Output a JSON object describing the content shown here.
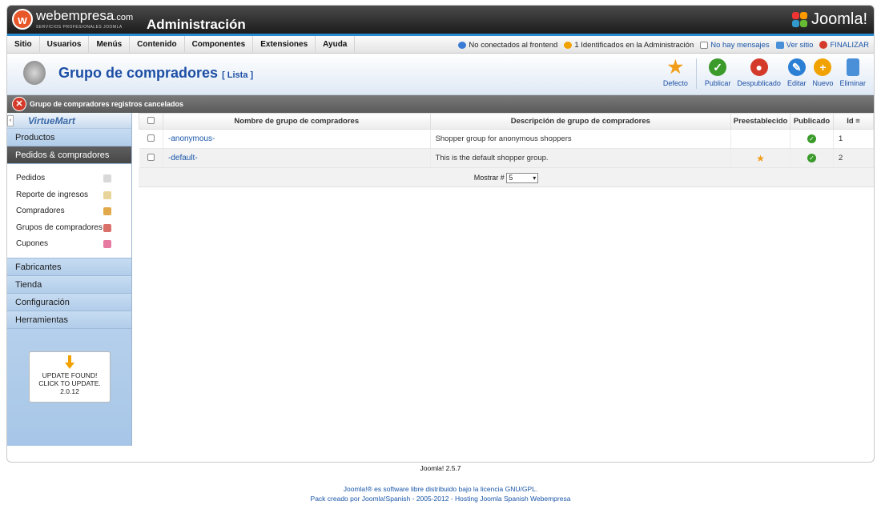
{
  "header": {
    "brand_name": "webempresa",
    "brand_suffix": ".com",
    "brand_tagline": "SERVICIOS PROFESIONALES JOOMLA",
    "title": "Administración",
    "cms_logo": "Joomla!"
  },
  "menu": [
    "Sitio",
    "Usuarios",
    "Menús",
    "Contenido",
    "Componentes",
    "Extensiones",
    "Ayuda"
  ],
  "status": {
    "frontend": "No conectados al frontend",
    "admin": "1 Identificados en la Administración",
    "messages": "No hay mensajes",
    "view_site": "Ver sitio",
    "logout": "FINALIZAR"
  },
  "toolbar": {
    "title": "Grupo de compradores",
    "subtitle": "[ Lista ]",
    "buttons": [
      "Defecto",
      "Publicar",
      "Despublicado",
      "Editar",
      "Nuevo",
      "Eliminar"
    ]
  },
  "message": "Grupo de compradores registros cancelados",
  "sidebar": {
    "logo": "VirtueMart",
    "sections": {
      "productos": "Productos",
      "pedidos": "Pedidos & compradores",
      "fabricantes": "Fabricantes",
      "tienda": "Tienda",
      "configuracion": "Configuración",
      "herramientas": "Herramientas"
    },
    "subitems": [
      "Pedidos",
      "Reporte de ingresos",
      "Compradores",
      "Grupos de compradores",
      "Cupones"
    ],
    "update": {
      "line1": "UPDATE FOUND!",
      "line2": "CLICK TO UPDATE.",
      "version": "2.0.12"
    }
  },
  "table": {
    "headers": {
      "name": "Nombre de grupo de compradores",
      "description": "Descripción de grupo de compradores",
      "default": "Preestablecido",
      "published": "Publicado",
      "id": "Id"
    },
    "rows": [
      {
        "name": "-anonymous-",
        "description": "Shopper group for anonymous shoppers",
        "default": false,
        "published": true,
        "id": "1"
      },
      {
        "name": "-default-",
        "description": "This is the default shopper group.",
        "default": true,
        "published": true,
        "id": "2"
      }
    ],
    "pager_label": "Mostrar #",
    "pager_value": "5"
  },
  "footer": {
    "version": "Joomla! 2.5.7",
    "license": "Joomla!® es software libre distribuido bajo la licencia GNU/GPL.",
    "credits": "Pack creado por Joomla!Spanish - 2005-2012 - Hosting Joomla Spanish Webempresa"
  },
  "colors": {
    "accent_blue": "#1d4fa5",
    "header_bar": "#2b8ad0",
    "ok_green": "#3a9a2a",
    "error_red": "#d43a2a"
  }
}
